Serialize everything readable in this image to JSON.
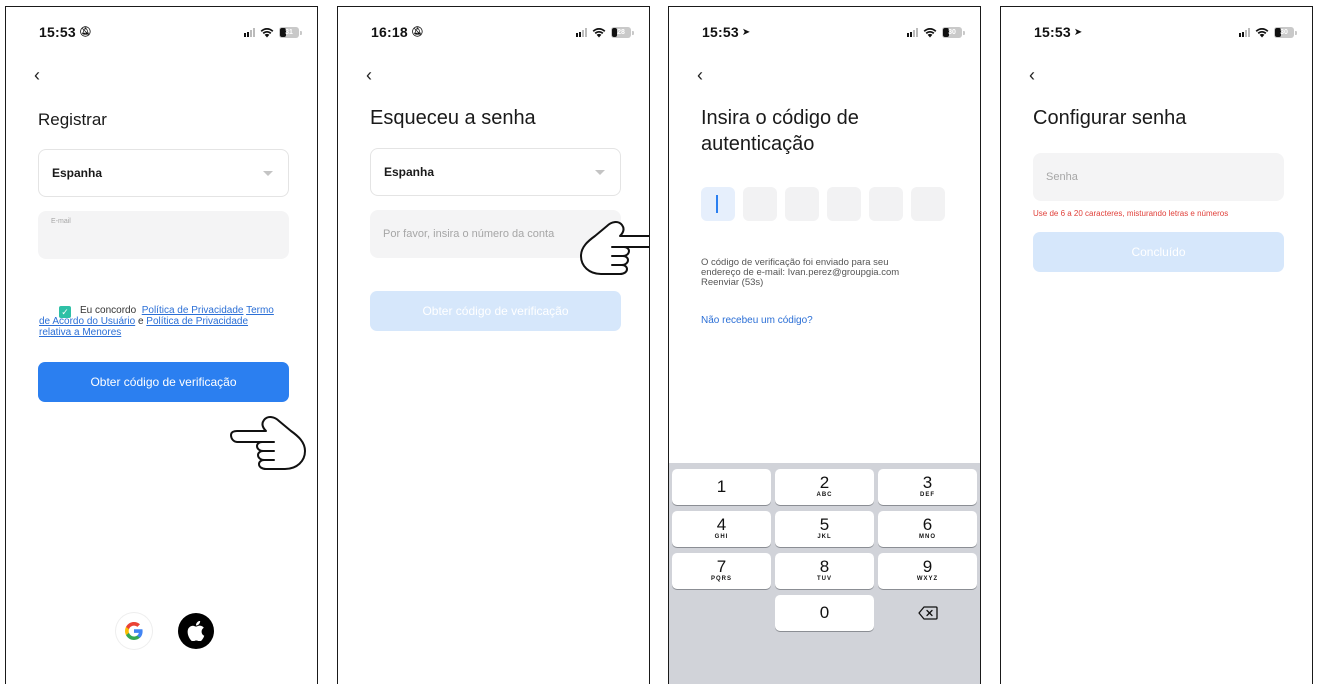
{
  "screens": [
    {
      "status": {
        "time": "15:53",
        "indicator": "silent",
        "battery": "31"
      },
      "title": "Registrar",
      "country": "Espanha",
      "email_label": "E-mail",
      "consent": {
        "prefix": "Eu concordo",
        "privacy_policy": "Política de Privacidade",
        "terms": "Termo de Acordo do Usuário",
        "conjunction": "e",
        "minors_policy": "Política de Privacidade relativa a Menores"
      },
      "button": "Obter código de verificação",
      "social_icons": [
        "google-icon",
        "apple-icon"
      ]
    },
    {
      "status": {
        "time": "16:18",
        "indicator": "silent",
        "battery": "28"
      },
      "title": "Esqueceu a senha",
      "country": "Espanha",
      "account_placeholder": "Por favor, insira o número da conta",
      "button": "Obter código de verificação"
    },
    {
      "status": {
        "time": "15:53",
        "indicator": "location",
        "battery": "30"
      },
      "title_line1": "Insira o código de",
      "title_line2": "autenticação",
      "code_length": 6,
      "info_line1": "O código de verificação foi enviado para seu",
      "info_line2": "endereço de e-mail: Ivan.perez@groupgia.com",
      "resend": "Reenviar (53s)",
      "no_code_link": "Não recebeu um código?",
      "keypad": [
        {
          "num": "1",
          "letters": ""
        },
        {
          "num": "2",
          "letters": "ABC"
        },
        {
          "num": "3",
          "letters": "DEF"
        },
        {
          "num": "4",
          "letters": "GHI"
        },
        {
          "num": "5",
          "letters": "JKL"
        },
        {
          "num": "6",
          "letters": "MNO"
        },
        {
          "num": "7",
          "letters": "PQRS"
        },
        {
          "num": "8",
          "letters": "TUV"
        },
        {
          "num": "9",
          "letters": "WXYZ"
        },
        {
          "num": "0",
          "letters": ""
        }
      ]
    },
    {
      "status": {
        "time": "15:53",
        "indicator": "location",
        "battery": "30"
      },
      "title": "Configurar senha",
      "password_placeholder": "Senha",
      "error": "Use de 6 a 20 caracteres, misturando letras e números",
      "button": "Concluído"
    }
  ],
  "colors": {
    "primary": "#2b7ff0",
    "primary_disabled": "#d6e7fb",
    "link": "#2b6fd6",
    "checkbox": "#2ec0a6",
    "error": "#e0403a",
    "field_bg": "#f4f4f5",
    "keyboard_bg": "#d1d3d9"
  }
}
